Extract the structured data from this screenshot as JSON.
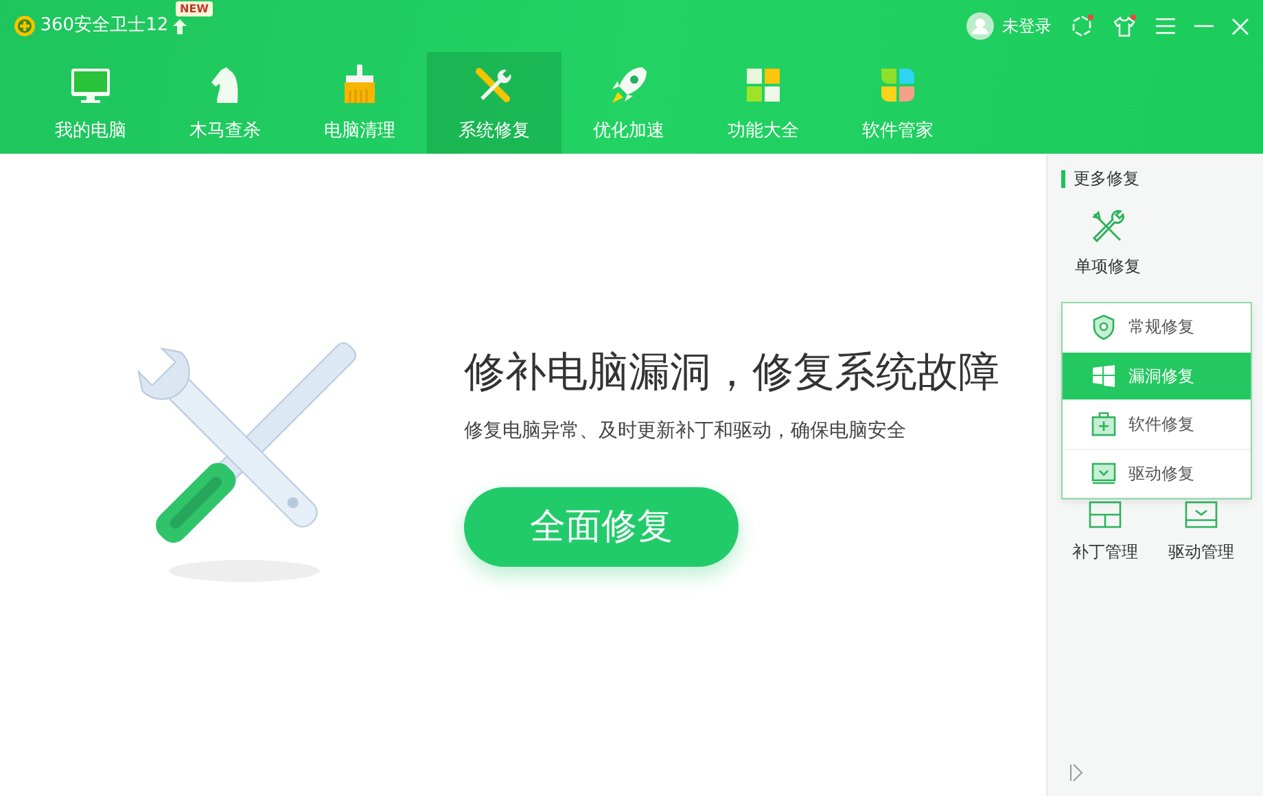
{
  "app": {
    "title": "360安全卫士12",
    "badge": "NEW"
  },
  "account": {
    "label": "未登录"
  },
  "nav": [
    {
      "kind": "monitor",
      "label": "我的电脑",
      "selected": false
    },
    {
      "kind": "horse",
      "label": "木马查杀",
      "selected": false
    },
    {
      "kind": "brush",
      "label": "电脑清理",
      "selected": false
    },
    {
      "kind": "tools",
      "label": "系统修复",
      "selected": true
    },
    {
      "kind": "rocket",
      "label": "优化加速",
      "selected": false
    },
    {
      "kind": "squares",
      "label": "功能大全",
      "selected": false
    },
    {
      "kind": "petals",
      "label": "软件管家",
      "selected": false
    }
  ],
  "hero": {
    "headline": "修补电脑漏洞，修复系统故障",
    "subtitle": "修复电脑异常、及时更新补丁和驱动，确保电脑安全",
    "button": "全面修复"
  },
  "sidebar": {
    "heading": "更多修复",
    "main_item": "单项修复",
    "items": [
      {
        "kind": "patch",
        "label": "补丁管理"
      },
      {
        "kind": "driver",
        "label": "驱动管理"
      }
    ]
  },
  "popup_menu": [
    {
      "kind": "shield",
      "label": "常规修复",
      "selected": false
    },
    {
      "kind": "windows",
      "label": "漏洞修复",
      "selected": true
    },
    {
      "kind": "kit",
      "label": "软件修复",
      "selected": false
    },
    {
      "kind": "driver",
      "label": "驱动修复",
      "selected": false
    }
  ]
}
